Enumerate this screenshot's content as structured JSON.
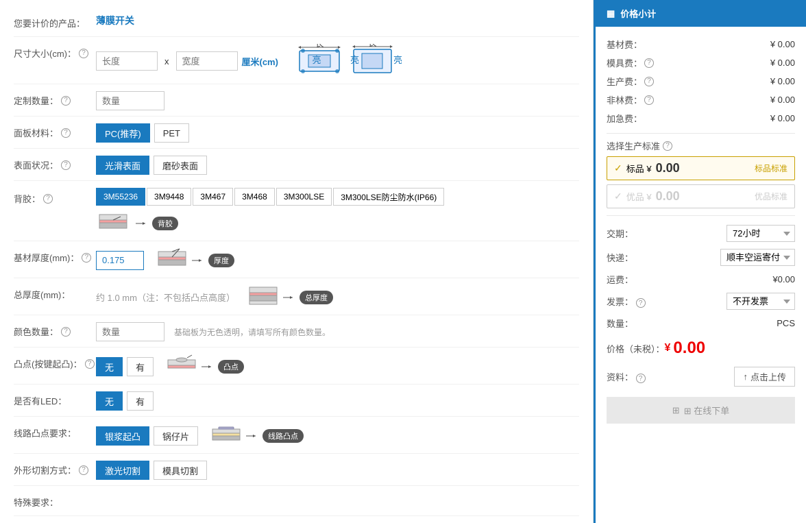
{
  "product": {
    "label": "您要计价的产品：",
    "name": "薄膜开关"
  },
  "size": {
    "label": "尺寸大小(cm)：",
    "length_placeholder": "长度",
    "width_placeholder": "宽度",
    "unit": "厘米(cm)",
    "unit_highlight": "厘米(cm)"
  },
  "quantity": {
    "label": "定制数量：",
    "placeholder": "数量"
  },
  "material": {
    "label": "面板材料：",
    "options": [
      "PC(推荐)",
      "PET"
    ]
  },
  "surface": {
    "label": "表面状况：",
    "options": [
      "光滑表面",
      "磨砂表面"
    ]
  },
  "adhesive": {
    "label": "背胶：",
    "options": [
      "3M55236",
      "3M9448",
      "3M467",
      "3M468",
      "3M300LSE",
      "3M300LSE防尘防水(IP66)"
    ],
    "diagram_label": "背胶"
  },
  "base_thickness": {
    "label": "基材厚度(mm)：",
    "value": "0.175",
    "diagram_label": "厚度"
  },
  "total_thickness": {
    "label": "总厚度(mm)：",
    "value": "约 1.0 mm（注：不包括凸点高度）",
    "diagram_label": "总厚度"
  },
  "color_qty": {
    "label": "颜色数量：",
    "placeholder": "数量",
    "desc": "基础板为无色透明，请填写所有颜色数量。"
  },
  "bump": {
    "label": "凸点(按键起凸)：",
    "options": [
      "无",
      "有"
    ],
    "diagram_label": "凸点"
  },
  "led": {
    "label": "是否有LED：",
    "options": [
      "无",
      "有"
    ]
  },
  "line_bump": {
    "label": "线路凸点要求：",
    "options": [
      "银浆起凸",
      "锅仔片"
    ],
    "diagram_label": "线路凸点"
  },
  "cut": {
    "label": "外形切割方式：",
    "options": [
      "激光切割",
      "模具切割"
    ]
  },
  "special": {
    "label": "特殊要求："
  },
  "pricing": {
    "title": "价格小计",
    "base_material_label": "基材费：",
    "base_material_value": "¥ 0.00",
    "mold_label": "模具费：",
    "mold_value": "¥ 0.00",
    "production_label": "生产费：",
    "production_value": "¥ 0.00",
    "nonlin_label": "非林费：",
    "nonlin_value": "¥ 0.00",
    "urgent_label": "加急费：",
    "urgent_value": "¥ 0.00",
    "std_select_label": "选择生产标准",
    "std_option1_price": "0.00",
    "std_option1_name": "标品标准",
    "std_option1_prefix": "标品 ¥",
    "std_option2_price": "0.00",
    "std_option2_name": "优品标准",
    "std_option2_prefix": "优品 ¥",
    "delivery_label": "交期：",
    "delivery_value": "72小时",
    "shipping_label": "快递：",
    "shipping_value": "顺丰空运寄付",
    "freight_label": "运费：",
    "freight_value": "¥0.00",
    "invoice_label": "发票：",
    "invoice_value": "不开发票",
    "qty_label": "数量：",
    "qty_value": "PCS",
    "price_label": "价格（未税）：",
    "price_symbol": "¥",
    "price_value": "0.00",
    "material_label": "资料：",
    "upload_label": "↑ 点击上传",
    "order_label": "⊞ 在线下单"
  }
}
